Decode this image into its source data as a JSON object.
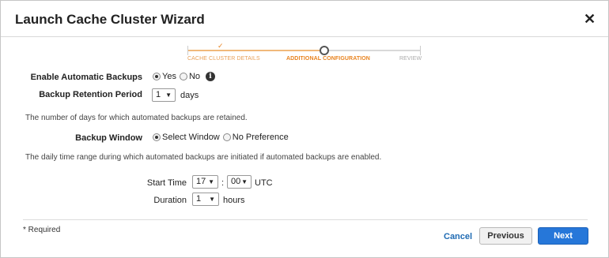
{
  "dialog": {
    "title": "Launch Cache Cluster Wizard",
    "close_glyph": "✕"
  },
  "steps": {
    "items": [
      "CACHE CLUSTER DETAILS",
      "ADDITIONAL CONFIGURATION",
      "REVIEW"
    ],
    "current": 1,
    "check_glyph": "✓"
  },
  "backups": {
    "enable_label": "Enable Automatic Backups",
    "enable_options": [
      "Yes",
      "No"
    ],
    "enable_selected": "Yes",
    "info_glyph": "i",
    "retention_label": "Backup Retention Period",
    "retention_value": "1",
    "retention_unit": "days",
    "retention_help": "The number of days for which automated backups are retained.",
    "window_label": "Backup Window",
    "window_options": [
      "Select Window",
      "No Preference"
    ],
    "window_selected": "Select Window",
    "window_help": "The daily time range during which automated backups are initiated if automated backups are enabled.",
    "start_time_label": "Start Time",
    "start_hour": "17",
    "time_separator": ":",
    "start_minute": "00",
    "timezone": "UTC",
    "duration_label": "Duration",
    "duration_value": "1",
    "duration_unit": "hours"
  },
  "footer": {
    "required_note": "* Required",
    "cancel_label": "Cancel",
    "previous_label": "Previous",
    "next_label": "Next"
  },
  "colors": {
    "accent": "#e8831f",
    "primary_button": "#2677d9",
    "link": "#1f6bb3"
  }
}
